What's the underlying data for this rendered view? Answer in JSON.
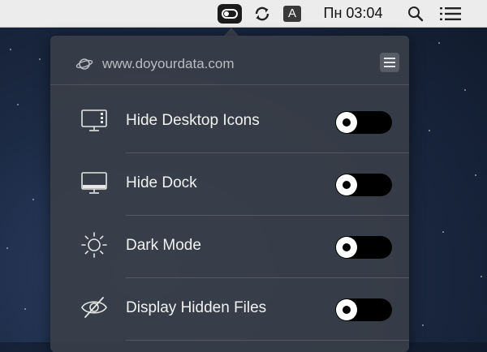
{
  "menubar": {
    "status_icons": [
      "toggle-switch-icon",
      "sync-icon",
      "input-source-icon",
      "search-icon",
      "list-icon"
    ],
    "input_source_label": "A",
    "clock": "Пн 03:04"
  },
  "panel": {
    "site_url": "www.doyourdata.com",
    "items": [
      {
        "label": "Hide Desktop Icons",
        "icon": "desktop-icons-icon",
        "enabled": false
      },
      {
        "label": "Hide Dock",
        "icon": "dock-icon",
        "enabled": false
      },
      {
        "label": "Dark Mode",
        "icon": "sun-icon",
        "enabled": false
      },
      {
        "label": "Display Hidden Files",
        "icon": "eye-slash-icon",
        "enabled": false
      }
    ]
  },
  "colors": {
    "panel_bg": "#393e48",
    "menubar_bg": "#ececec",
    "switch_off": "#000000",
    "label_text": "#f1f1f1"
  }
}
